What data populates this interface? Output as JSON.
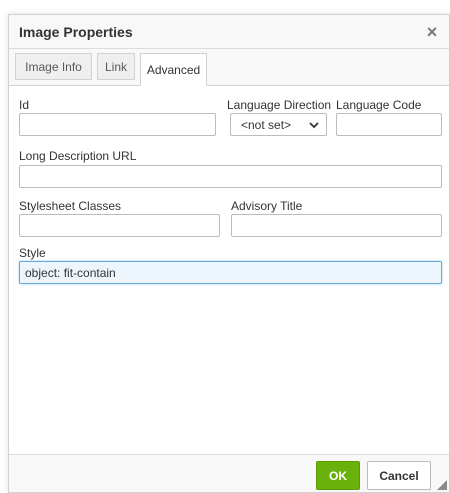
{
  "dialog": {
    "title": "Image Properties",
    "close_symbol": "×",
    "icons": {
      "close": "close-icon",
      "dropdown": "chevron-down-icon",
      "resize": "resize-grip-icon"
    }
  },
  "tabs": [
    {
      "label": "Image Info",
      "active": false
    },
    {
      "label": "Link",
      "active": false
    },
    {
      "label": "Advanced",
      "active": true
    }
  ],
  "fields": {
    "id": {
      "label": "Id",
      "value": ""
    },
    "language_direction": {
      "label": "Language Direction",
      "selected": "<not set>"
    },
    "language_code": {
      "label": "Language Code",
      "value": ""
    },
    "long_description_url": {
      "label": "Long Description URL",
      "value": ""
    },
    "stylesheet_classes": {
      "label": "Stylesheet Classes",
      "value": ""
    },
    "advisory_title": {
      "label": "Advisory Title",
      "value": ""
    },
    "style": {
      "label": "Style",
      "value": "object: fit-contain"
    }
  },
  "buttons": {
    "ok": "OK",
    "cancel": "Cancel"
  },
  "colors": {
    "ok_button": "#69b10b",
    "focus_border": "#66abd8",
    "focus_bg": "#eef6fd"
  }
}
